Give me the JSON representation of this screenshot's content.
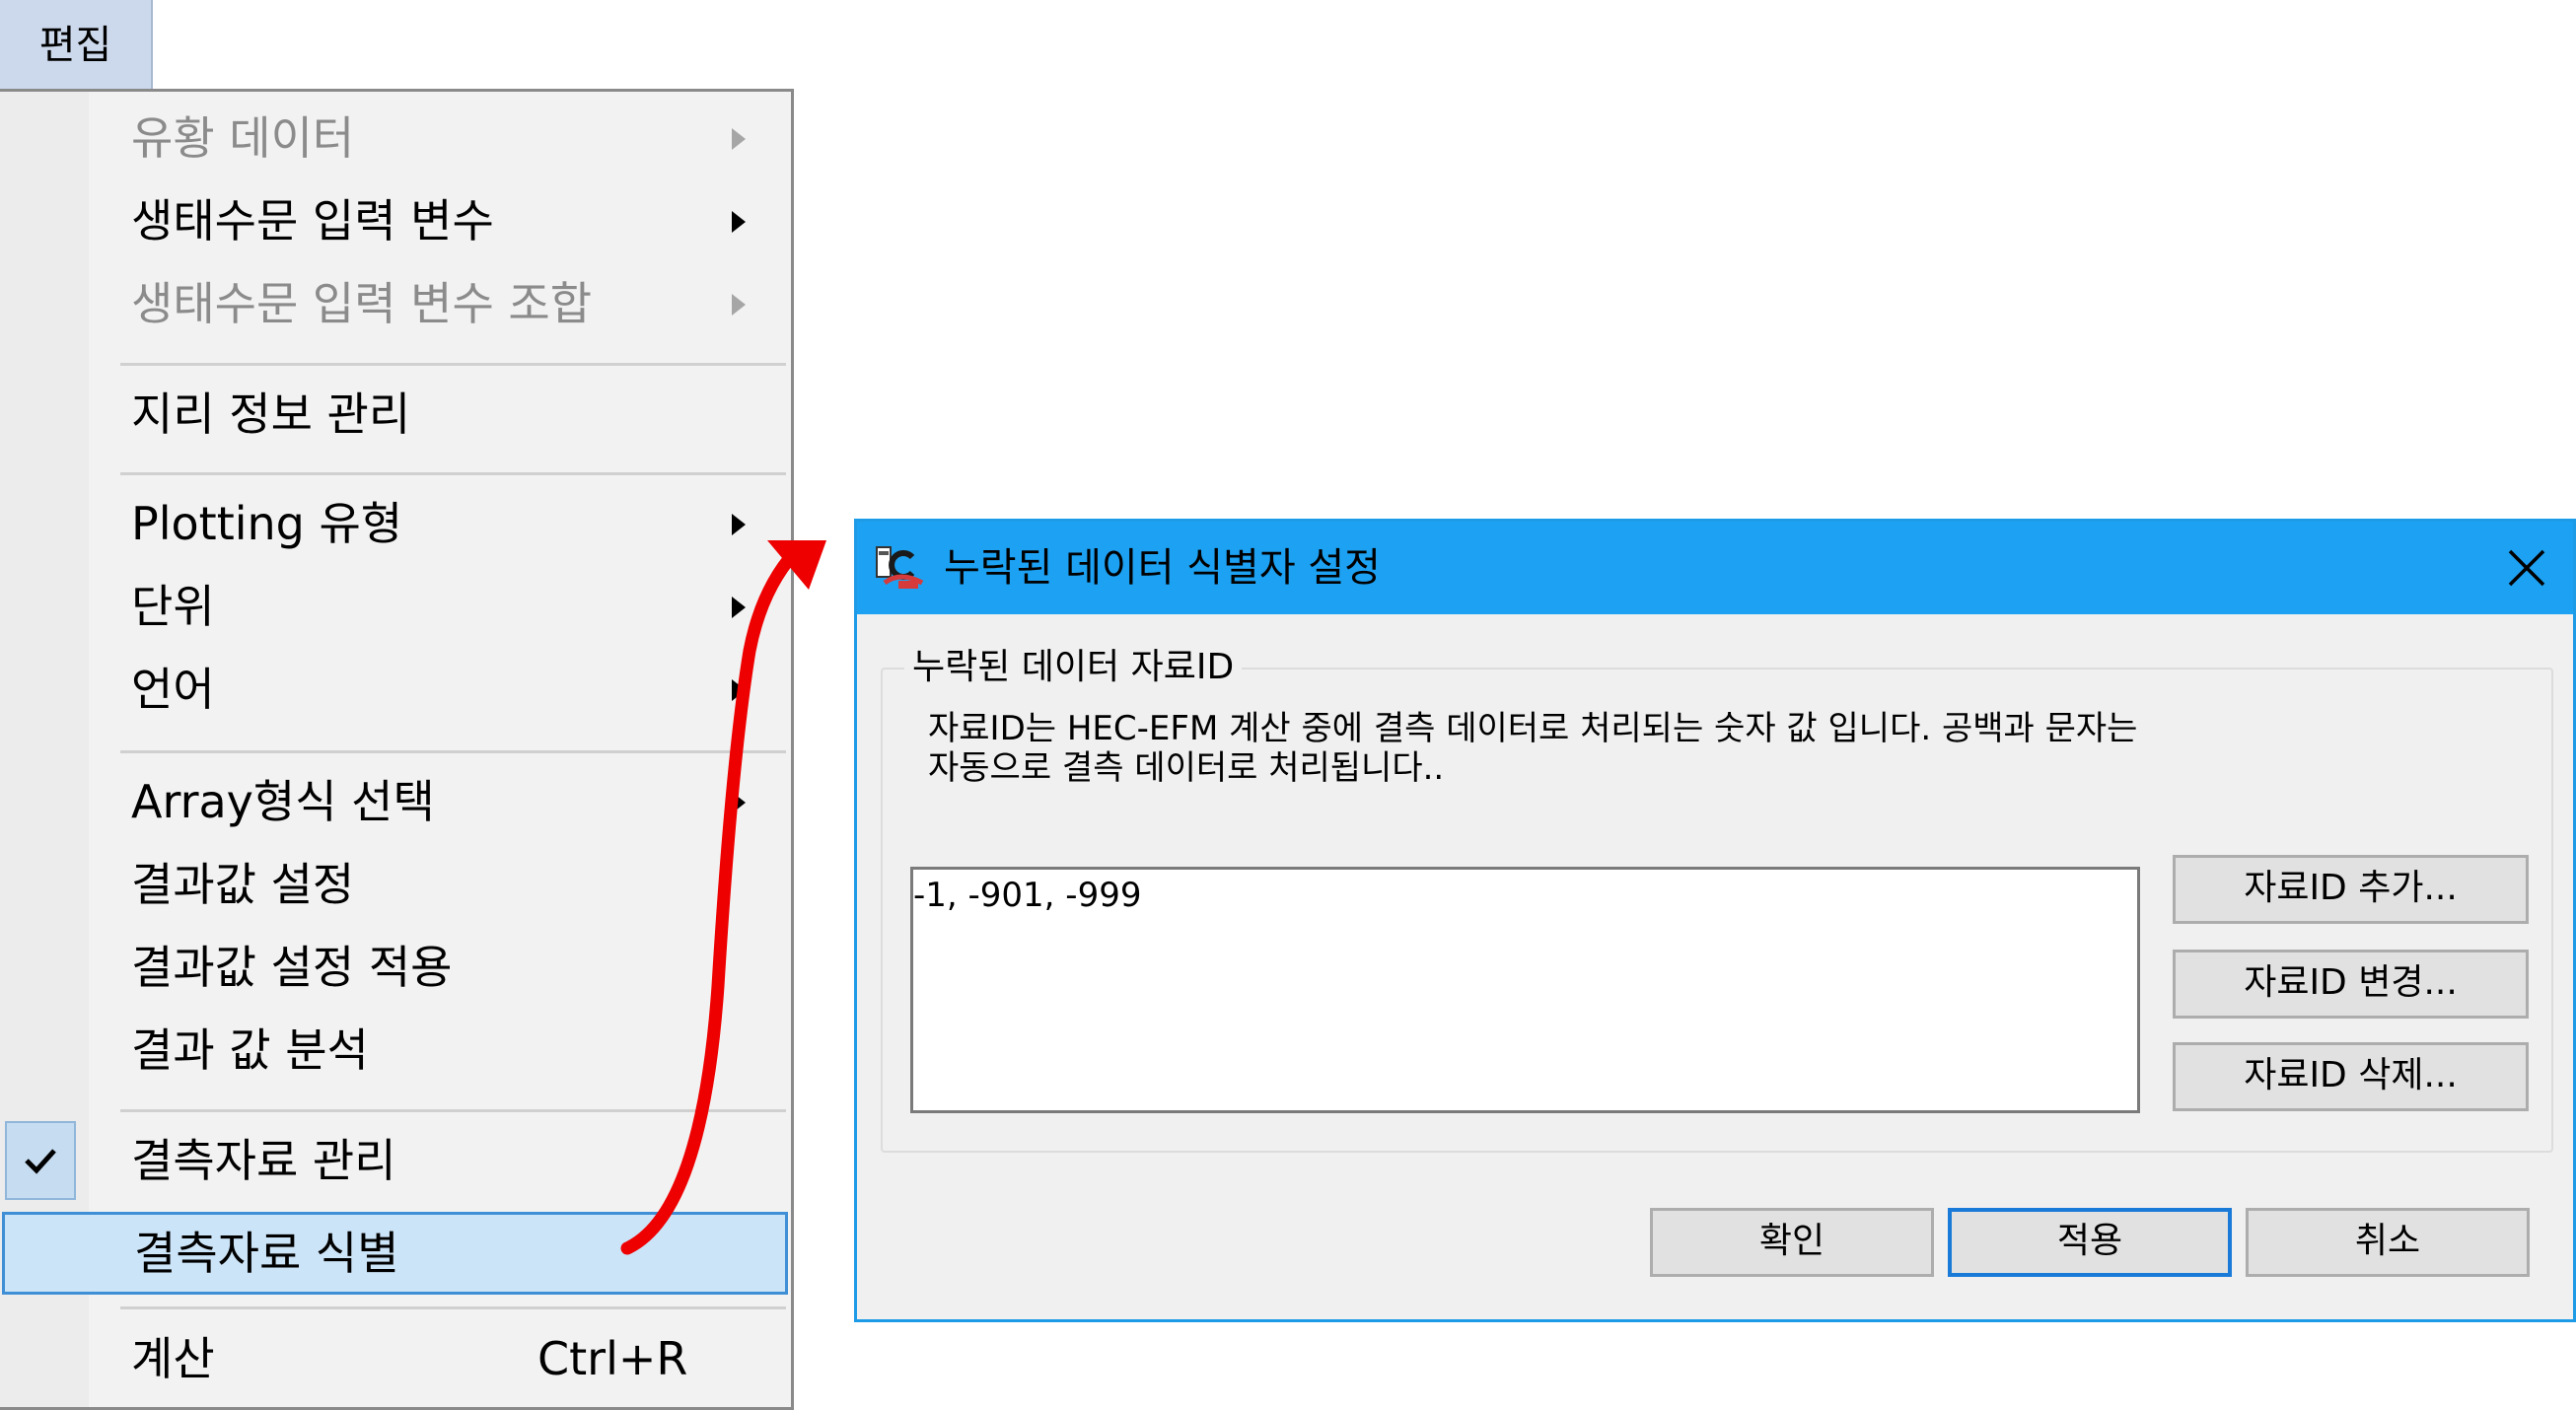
{
  "menubar": {
    "title": "편집"
  },
  "menu": {
    "items": [
      {
        "label": "유황 데이터",
        "disabled": true,
        "submenu": true
      },
      {
        "label": "생태수문 입력 변수",
        "disabled": false,
        "submenu": true
      },
      {
        "label": "생태수문 입력 변수 조합",
        "disabled": true,
        "submenu": true
      },
      {
        "label": "지리 정보 관리"
      },
      {
        "label": "Plotting  유형",
        "submenu": true
      },
      {
        "label": "단위",
        "submenu": true
      },
      {
        "label": "언어",
        "submenu": true
      },
      {
        "label": "Array형식 선택",
        "submenu": true
      },
      {
        "label": "결과값 설정"
      },
      {
        "label": "결과값 설정 적용"
      },
      {
        "label": "결과 값 분석"
      },
      {
        "label": "결측자료 관리",
        "checked": true
      },
      {
        "label": "결측자료 식별",
        "highlighted": true
      },
      {
        "label": "계산",
        "shortcut": "Ctrl+R"
      }
    ]
  },
  "dialog": {
    "title": "누락된 데이터 식별자 설정",
    "group_label": "누락된 데이터 자료ID",
    "description": "자료ID는 HEC-EFM 계산 중에 결측 데이터로 처리되는 숫자 값 입니다. 공백과 문자는\n자동으로 결측 데이터로 처리됩니다..",
    "list_value": "-1, -901, -999",
    "side_buttons": {
      "add": "자료ID 추가...",
      "edit": "자료ID 변경...",
      "delete": "자료ID 삭제..."
    },
    "bottom_buttons": {
      "ok": "확인",
      "apply": "적용",
      "cancel": "취소"
    }
  },
  "colors": {
    "titlebar": "#1da1f2",
    "highlight": "#cce4f7",
    "highlight_border": "#3f8fd6",
    "arrow": "#ee0000"
  }
}
